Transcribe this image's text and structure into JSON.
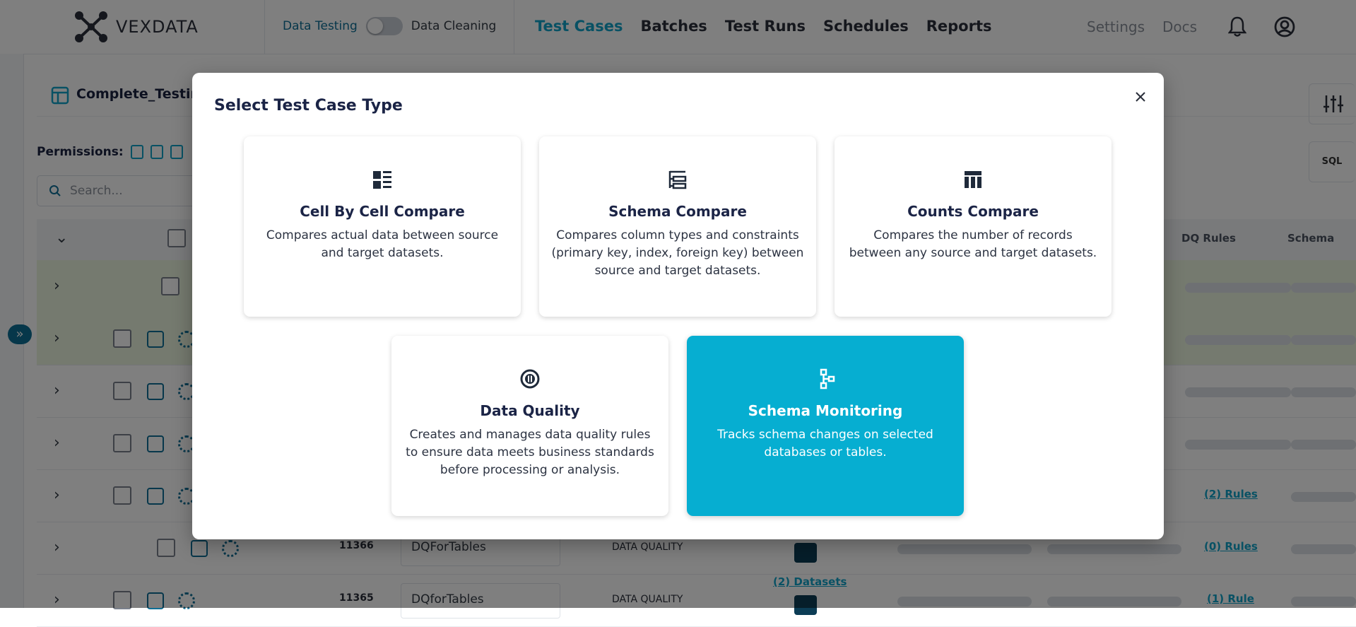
{
  "app": {
    "brand": "VEXDATA"
  },
  "mode_toggle": {
    "left_label": "Data Testing",
    "right_label": "Data Cleaning"
  },
  "nav": {
    "items": [
      "Test Cases",
      "Batches",
      "Test Runs",
      "Schedules",
      "Reports"
    ],
    "active": "Test Cases",
    "right_items": [
      "Settings",
      "Docs"
    ]
  },
  "icons": {
    "notifications": "bell-icon",
    "account": "user-circle-icon",
    "logo": "network-nodes-icon",
    "close": "close-icon"
  },
  "page": {
    "title": "Complete_Testing",
    "permissions_label": "Permissions:",
    "search_placeholder": "Search...",
    "sql_button": "SQL",
    "columns": [
      "DQ Rules",
      "Schema"
    ],
    "rows": [
      {
        "id": "11366",
        "name": "DQForTables",
        "type": "DATA QUALITY",
        "datasets": "",
        "rules": "(0) Rules"
      },
      {
        "id": "11365",
        "name": "DQforTables",
        "type": "DATA QUALITY",
        "datasets": "(2) Datasets",
        "rules": "(1) Rule"
      }
    ],
    "extra_rules": "(2) Rules"
  },
  "modal": {
    "title": "Select Test Case Type",
    "cards": [
      {
        "title": "Cell By Cell Compare",
        "description": "Compares actual data between source and target datasets.",
        "icon": "list-compare-icon"
      },
      {
        "title": "Schema Compare",
        "description": "Compares column types and constraints (primary key, index, foreign key) between source and target datasets.",
        "icon": "schema-tree-icon"
      },
      {
        "title": "Counts Compare",
        "description": "Compares the number of records between any source and target datasets.",
        "icon": "table-columns-icon"
      },
      {
        "title": "Data Quality",
        "description": "Creates and manages data quality rules to ensure data meets business standards before processing or analysis.",
        "icon": "quality-gauge-icon"
      },
      {
        "title": "Schema Monitoring",
        "description": "Tracks schema changes on selected databases or tables.",
        "icon": "schema-monitor-icon"
      }
    ]
  },
  "colors": {
    "accent": "#06aed1",
    "brand_dark": "#0e6f96",
    "title": "#1b2446"
  }
}
